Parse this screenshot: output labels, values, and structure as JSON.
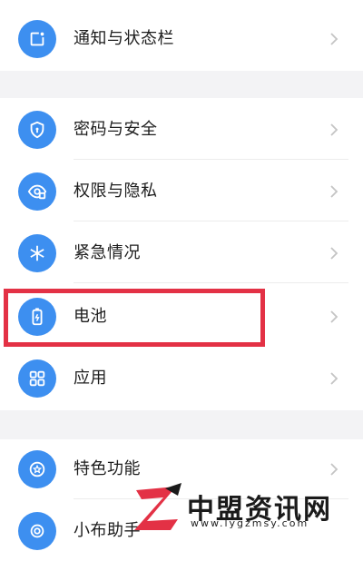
{
  "settings": {
    "items": [
      {
        "label": "通知与状态栏",
        "icon": "notification-icon"
      },
      {
        "label": "密码与安全",
        "icon": "shield-icon"
      },
      {
        "label": "权限与隐私",
        "icon": "privacy-icon"
      },
      {
        "label": "紧急情况",
        "icon": "emergency-icon"
      },
      {
        "label": "电池",
        "icon": "battery-icon"
      },
      {
        "label": "应用",
        "icon": "apps-grid-icon"
      },
      {
        "label": "特色功能",
        "icon": "special-features-icon"
      },
      {
        "label": "小布助手",
        "icon": "assistant-icon"
      }
    ]
  },
  "colors": {
    "icon_bg": "#3d8ff0",
    "highlight": "#e33145",
    "section_gap": "#f3f3f5"
  },
  "watermark": {
    "title": "中盟资讯网",
    "url": "www.lygzmsy.com"
  }
}
